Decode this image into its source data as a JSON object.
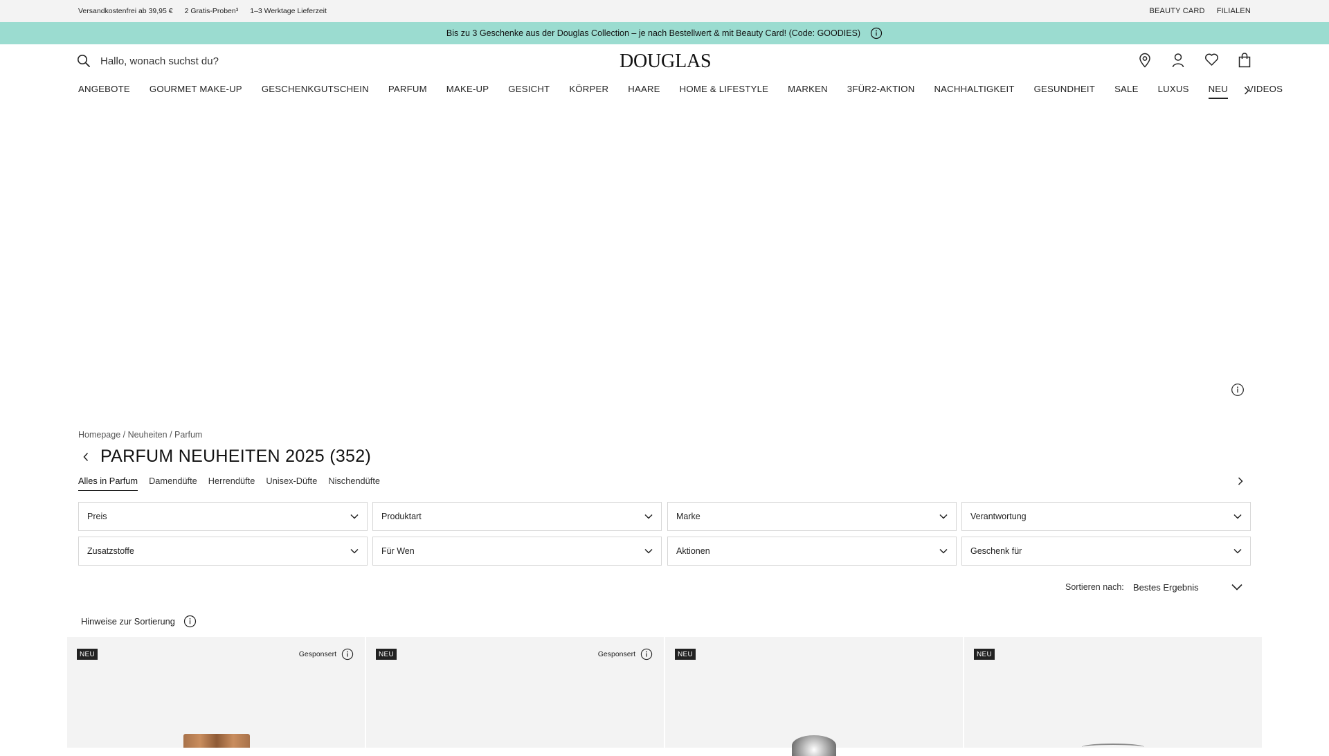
{
  "topbar": {
    "left": [
      "Versandkostenfrei ab 39,95 €",
      "2 Gratis-Proben³",
      "1–3 Werktage Lieferzeit"
    ],
    "right": [
      "BEAUTY CARD",
      "FILIALEN"
    ]
  },
  "promo": {
    "text": "Bis zu 3 Geschenke aus der Douglas Collection – je nach Bestellwert & mit Beauty Card! (Code: GOODIES)"
  },
  "header": {
    "search_placeholder": "Hallo, wonach suchst du?",
    "logo": "DOUGLAS",
    "icons": [
      "location-icon",
      "account-icon",
      "wishlist-icon",
      "cart-icon"
    ]
  },
  "nav": {
    "items": [
      "ANGEBOTE",
      "GOURMET MAKE-UP",
      "GESCHENKGUTSCHEIN",
      "PARFUM",
      "MAKE-UP",
      "GESICHT",
      "KÖRPER",
      "HAARE",
      "HOME & LIFESTYLE",
      "MARKEN",
      "3FÜR2-AKTION",
      "NACHHALTIGKEIT",
      "GESUNDHEIT",
      "SALE",
      "LUXUS",
      "NEU",
      "VIDEOS"
    ],
    "active": "NEU"
  },
  "breadcrumb": [
    "Homepage",
    "Neuheiten",
    "Parfum"
  ],
  "page": {
    "title": "PARFUM NEUHEITEN 2025",
    "count": "(352)"
  },
  "subtabs": [
    "Alles in Parfum",
    "Damendüfte",
    "Herrendüfte",
    "Unisex-Düfte",
    "Nischendüfte"
  ],
  "filters": [
    "Preis",
    "Produktart",
    "Marke",
    "Verantwortung",
    "Zusatzstoffe",
    "Für Wen",
    "Aktionen",
    "Geschenk für"
  ],
  "sort": {
    "label": "Sortieren nach:",
    "value": "Bestes Ergebnis"
  },
  "hint": {
    "text": "Hinweise zur Sortierung"
  },
  "products": [
    {
      "badge": "NEU",
      "sponsored": "Gesponsert"
    },
    {
      "badge": "NEU",
      "sponsored": "Gesponsert"
    },
    {
      "badge": "NEU",
      "sponsored": ""
    },
    {
      "badge": "NEU",
      "sponsored": ""
    }
  ],
  "colors": {
    "promo_bg": "#9bdcd0",
    "topbar_bg": "#f3f3f3",
    "card_bg": "#f3f3f3",
    "text": "#222222"
  }
}
